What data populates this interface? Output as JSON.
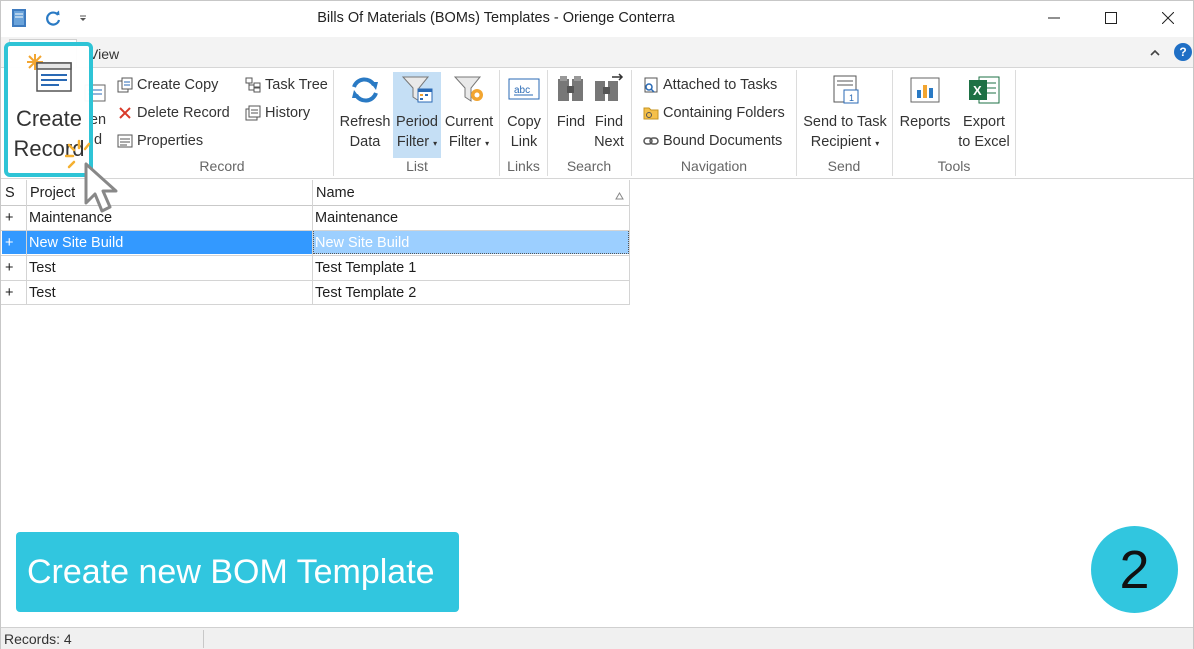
{
  "window": {
    "title": "Bills Of Materials (BOMs) Templates - Orienge Conterra"
  },
  "tabs": {
    "view": "View"
  },
  "ribbon": {
    "record": {
      "create_record": "Create Record",
      "open_record_partial_1": "en",
      "open_record_partial_2": "d",
      "create_copy": "Create Copy",
      "delete_record": "Delete Record",
      "properties": "Properties",
      "task_tree": "Task Tree",
      "history": "History",
      "group": "Record"
    },
    "list": {
      "refresh_1": "Refresh",
      "refresh_2": "Data",
      "period_1": "Period",
      "period_2": "Filter",
      "current_1": "Current",
      "current_2": "Filter",
      "group": "List"
    },
    "links": {
      "copy_1": "Copy",
      "copy_2": "Link",
      "group": "Links"
    },
    "search": {
      "find": "Find",
      "find_next_1": "Find",
      "find_next_2": "Next",
      "group": "Search"
    },
    "navigation": {
      "attached": "Attached to Tasks",
      "containing": "Containing Folders",
      "bound": "Bound Documents",
      "group": "Navigation"
    },
    "send": {
      "send_1": "Send to Task",
      "send_2": "Recipient",
      "group": "Send"
    },
    "tools": {
      "reports": "Reports",
      "export_1": "Export",
      "export_2": "to Excel",
      "group": "Tools"
    }
  },
  "grid": {
    "headers": {
      "s": "S",
      "project": "Project",
      "name": "Name"
    },
    "rows": [
      {
        "s": "+",
        "project": "Maintenance",
        "name": "Maintenance"
      },
      {
        "s": "+",
        "project": "New Site Build",
        "name": "New Site Build"
      },
      {
        "s": "+",
        "project": "Test",
        "name": "Test Template 1"
      },
      {
        "s": "+",
        "project": "Test",
        "name": "Test Template 2"
      }
    ]
  },
  "status": {
    "records": "Records: 4"
  },
  "callout": {
    "banner": "Create new BOM Template",
    "step": "2"
  },
  "colors": {
    "accent": "#31c6df",
    "selected_row": "#3399ff",
    "selected_cell": "#9ccfff"
  }
}
